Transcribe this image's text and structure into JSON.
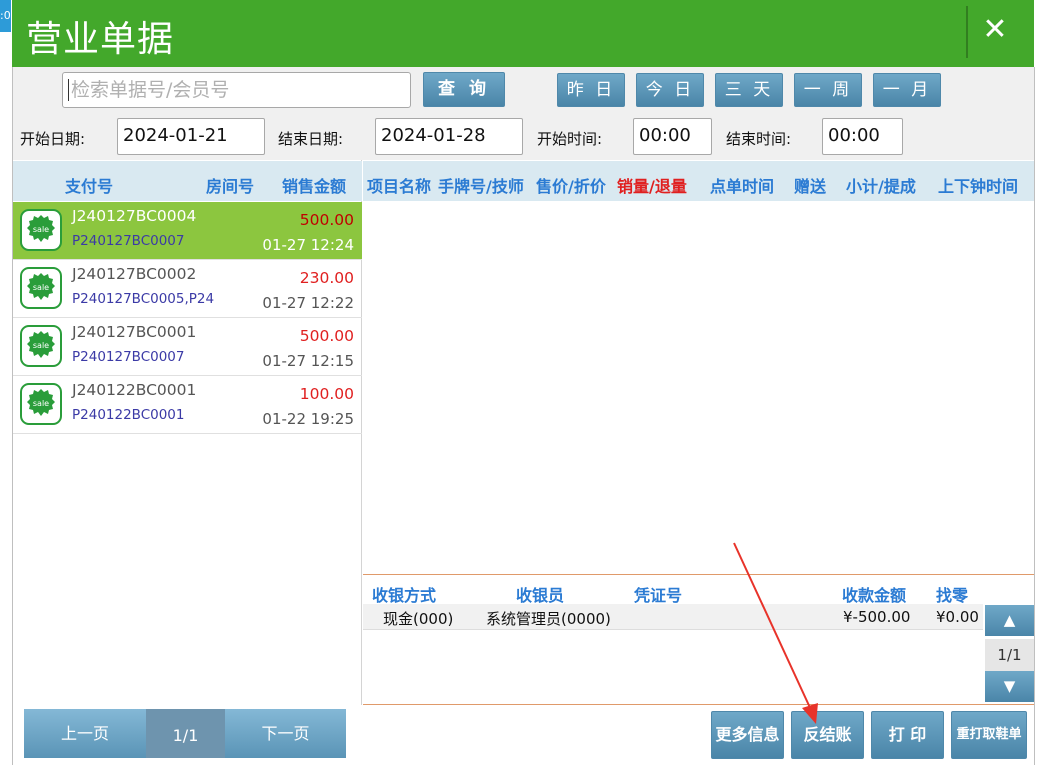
{
  "window": {
    "title": "营业单据",
    "close_glyph": "✕",
    "edge_text": ":0"
  },
  "filter": {
    "search_placeholder": "检索单据号/会员号",
    "search_value": "",
    "query_label": "查 询",
    "ranges": [
      "昨 日",
      "今 日",
      "三 天",
      "一 周",
      "一 月"
    ],
    "start_date_label": "开始日期:",
    "start_date": "2024-01-21",
    "end_date_label": "结束日期:",
    "end_date": "2024-01-28",
    "start_time_label": "开始时间:",
    "start_time": "00:00",
    "end_time_label": "结束时间:",
    "end_time": "00:00"
  },
  "records_header": {
    "pay_no": "支付号",
    "room_no": "房间号",
    "sales_amount": "销售金额"
  },
  "records": [
    {
      "bill_no": "J240127BC0004",
      "pay_no": "P240127BC0007",
      "amount": "500.00",
      "time": "01-27 12:24",
      "selected": true
    },
    {
      "bill_no": "J240127BC0002",
      "pay_no": "P240127BC0005,P24",
      "amount": "230.00",
      "time": "01-27 12:22",
      "selected": false
    },
    {
      "bill_no": "J240127BC0001",
      "pay_no": "P240127BC0007",
      "amount": "500.00",
      "time": "01-27 12:15",
      "selected": false
    },
    {
      "bill_no": "J240122BC0001",
      "pay_no": "P240122BC0001",
      "amount": "100.00",
      "time": "01-22 19:25",
      "selected": false
    }
  ],
  "icons": {
    "sale_badge": "sale-badge-icon",
    "sale_text": "sale",
    "up": "▲",
    "down": "▼"
  },
  "pager": {
    "prev": "上一页",
    "page": "1/1",
    "next": "下一页"
  },
  "detail_header": [
    "项目名称",
    "手牌号/技师",
    "售价/折价",
    "销量/退量",
    "点单时间",
    "赠送",
    "小计/提成",
    "上下钟时间"
  ],
  "payment_header": {
    "method": "收银方式",
    "cashier": "收银员",
    "voucher": "凭证号",
    "amount": "收款金额",
    "change": "找零"
  },
  "payments": [
    {
      "method": "现金(000)",
      "cashier": "系统管理员(0000)",
      "voucher": "",
      "amount": "¥-500.00",
      "change": "¥0.00"
    }
  ],
  "side_pager": {
    "page": "1/1"
  },
  "actions": {
    "more_info": "更多信息",
    "reverse_checkout": "反结账",
    "print": "打 印",
    "reprint_ticket": "重打取鞋单"
  },
  "colors": {
    "title_green": "#43a82b",
    "selected_row": "#8cc63f",
    "header_blue_text": "#2b7bd3",
    "amount_red": "#e02020",
    "button_blue": "#5a94b6"
  }
}
